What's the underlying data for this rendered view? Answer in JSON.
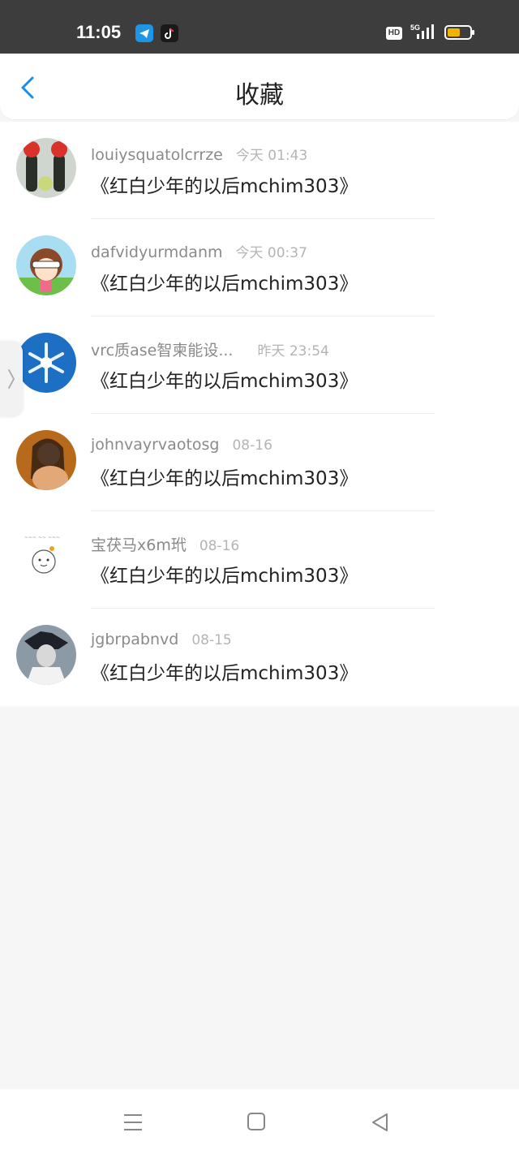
{
  "status_bar": {
    "time": "11:05",
    "hd": "HD",
    "network": "5G",
    "icons": [
      "telegram-icon",
      "tiktok-icon",
      "hd-icon",
      "signal-icon",
      "battery-icon"
    ]
  },
  "header": {
    "title": "收藏",
    "back_icon": "chevron-left-icon"
  },
  "favorites": [
    {
      "username": "louiysquatolcrrze",
      "time": "今天 01:43",
      "title": "《红白少年的以后mchim303》"
    },
    {
      "username": "dafvidyurmdanm",
      "time": "今天 00:37",
      "title": "《红白少年的以后mchim303》"
    },
    {
      "username": "vrc质ase智柬能设...",
      "time": "昨天 23:54",
      "title": "《红白少年的以后mchim303》"
    },
    {
      "username": "johnvayrvaotosg",
      "time": "08-16",
      "title": "《红白少年的以后mchim303》"
    },
    {
      "username": "宝茯马x6m玳",
      "time": "08-16",
      "title": "《红白少年的以后mchim303》"
    },
    {
      "username": "jgbrpabnvd",
      "time": "08-15",
      "title": "《红白少年的以后mchim303》"
    }
  ],
  "nav_bar": {
    "icons": [
      "menu-icon",
      "home-icon",
      "back-triangle-icon"
    ]
  },
  "colors": {
    "accent": "#1a8cf0",
    "status_bar_bg": "#3d3d3d",
    "page_bg": "#f7f6f7",
    "battery": "#f0b400"
  }
}
